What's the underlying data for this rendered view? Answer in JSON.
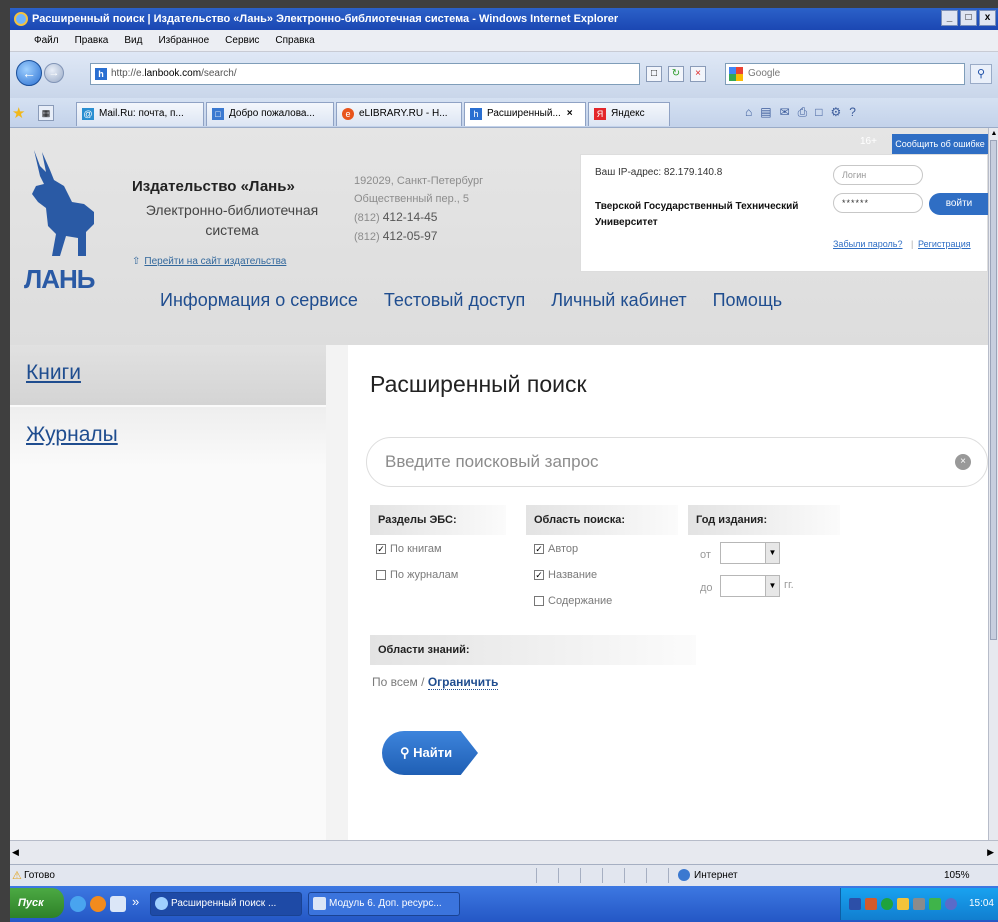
{
  "window": {
    "title": "Расширенный поиск | Издательство «Лань» Электронно-библиотечная система - Windows Internet Explorer",
    "min": "_",
    "max": "□",
    "close": "x"
  },
  "menu": [
    "Файл",
    "Правка",
    "Вид",
    "Избранное",
    "Сервис",
    "Справка"
  ],
  "address_bar": {
    "url_prefix": "http://e.",
    "url_domain": "lanbook.com",
    "url_path": "/search/",
    "search_placeholder": "Google"
  },
  "tabs": [
    {
      "label": "Mail.Ru: почта, п...",
      "color": "#2a8fd1"
    },
    {
      "label": "Добро пожалова...",
      "color": "#3b79d0"
    },
    {
      "label": "eLIBRARY.RU - Н...",
      "color": "#e8541c"
    },
    {
      "label": "Расширенный...",
      "color": "#2a6fd1",
      "active": true
    },
    {
      "label": "Яндекс",
      "color": "#e3262a"
    }
  ],
  "site": {
    "report_btn": "Сообщить об ошибке",
    "age": "16+",
    "logo_word": "ЛАНЬ",
    "pub_name": "Издательство «Лань»",
    "pub_sub": "Электронно-библиотечная система",
    "pub_link": "Перейти на сайт издательства",
    "address_lines": [
      "192029, Санкт-Петербург",
      "Общественный пер., 5"
    ],
    "phones": [
      {
        "code": "(812)",
        "num": "412-14-45"
      },
      {
        "code": "(812)",
        "num": "412-05-97"
      }
    ],
    "login": {
      "ip": "Ваш IP-адрес: 82.179.140.8",
      "university": "Тверской Государственный Технический Университет",
      "login_placeholder": "Логин",
      "password_mask": "******",
      "login_btn": "войти",
      "forgot": "Забыли пароль?",
      "sep": "|",
      "register": "Регистрация"
    },
    "nav": [
      "Информация о сервисе",
      "Тестовый доступ",
      "Личный кабинет",
      "Помощь"
    ]
  },
  "sidebar": [
    {
      "label": "Книги"
    },
    {
      "label": "Журналы"
    }
  ],
  "search": {
    "title": "Расширенный поиск",
    "placeholder": "Введите поисковый запрос",
    "sections_head": "Разделы ЭБС:",
    "sections": [
      {
        "label": "По книгам",
        "checked": true
      },
      {
        "label": "По журналам",
        "checked": false
      }
    ],
    "scope_head": "Область поиска:",
    "scope": [
      {
        "label": "Автор",
        "checked": true
      },
      {
        "label": "Название",
        "checked": true
      },
      {
        "label": "Содержание",
        "checked": false
      }
    ],
    "year_head": "Год издания:",
    "year_from": "от",
    "year_to": "до",
    "year_unit": "гг.",
    "knowledge_head": "Области знаний:",
    "all_label": "По всем /",
    "restrict_link": "Ограничить",
    "find_btn": "Найти"
  },
  "status": {
    "text": "Готово",
    "zone": "Интернет",
    "zoom": "105%"
  },
  "taskbar": {
    "start": "Пуск",
    "chevron": "»",
    "items": [
      "Расширенный поиск ...",
      "Модуль 6. Доп. ресурс..."
    ],
    "clock": "15:04"
  }
}
